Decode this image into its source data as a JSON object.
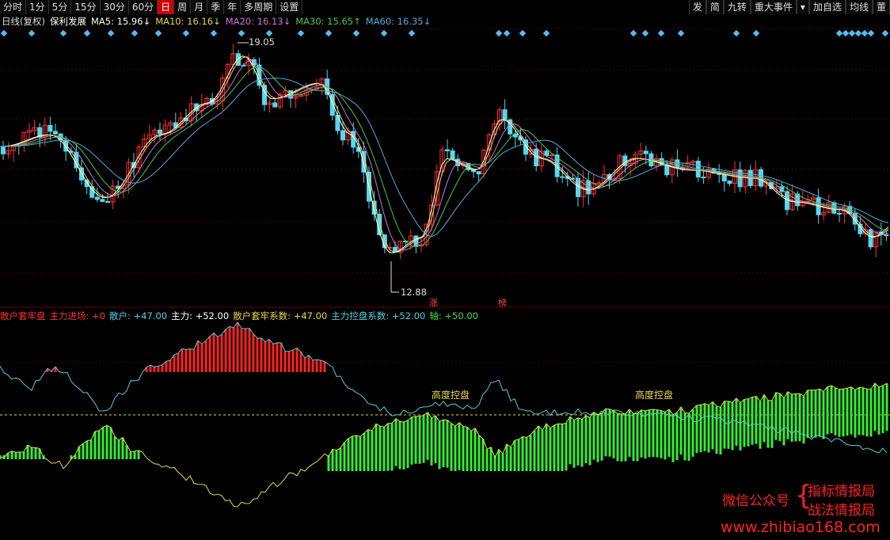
{
  "toolbar": {
    "tabs": [
      "分时",
      "1分",
      "5分",
      "15分",
      "30分",
      "60分",
      "日",
      "周",
      "月",
      "季",
      "年",
      "多周期",
      "设置"
    ],
    "active_index": 6,
    "right_buttons": [
      "发",
      "简",
      "九转",
      "重大事件",
      "▾",
      "加自选",
      "均线",
      "董"
    ]
  },
  "header": {
    "period": "日线(复权)",
    "stock_name": "保利发展",
    "ma": [
      {
        "label": "MA5: 15.96↓",
        "color": "#ffffff"
      },
      {
        "label": "MA10: 16.16↓",
        "color": "#e8d84a"
      },
      {
        "label": "MA20: 16.13↓",
        "color": "#d070e0"
      },
      {
        "label": "MA30: 15.65↑",
        "color": "#44cc44"
      },
      {
        "label": "MA60: 16.35↓",
        "color": "#55aadd"
      }
    ]
  },
  "price_chart": {
    "high_label": "19.05",
    "low_label": "12.88",
    "markers": [
      "涨",
      "榜"
    ]
  },
  "indicator": {
    "name": "散户套牢盘",
    "items": [
      {
        "label": "散户套牢盘",
        "color": "#ff3333"
      },
      {
        "label": "主力进场: +0",
        "color": "#ff3333"
      },
      {
        "label": "散户: +47.00",
        "color": "#55ccdd"
      },
      {
        "label": "主力: +52.00",
        "color": "#ffffff"
      },
      {
        "label": "散户套牢系数: +47.00",
        "color": "#e8d84a"
      },
      {
        "label": "主力控盘系数: +52.00",
        "color": "#55ccdd"
      },
      {
        "label": "轴: +50.00",
        "color": "#44dd44"
      }
    ],
    "annotations": [
      "高度控盘",
      "高度控盘"
    ]
  },
  "watermark": {
    "line1": "微信公众号",
    "line2a": "指标情报局",
    "line2b": "战法情报局",
    "url": "www.zhibiao168.com"
  },
  "colors": {
    "up": "#ff3030",
    "down": "#54d8f0",
    "active_tab": "#cc0000",
    "grid": "#5a0000",
    "green_bar": "#33ee33",
    "red_bar": "#ff2222"
  }
}
